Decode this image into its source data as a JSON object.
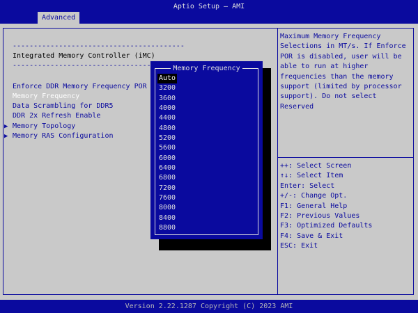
{
  "window": {
    "title": "Aptio Setup – AMI"
  },
  "tabs": [
    {
      "label": "Advanced"
    }
  ],
  "main": {
    "separator": "-----------------------------------------",
    "section_title": "Integrated Memory Controller (iMC)",
    "separator2": "----------------------------------",
    "items": [
      {
        "label": "Enforce DDR Memory Frequency POR"
      },
      {
        "label": "Memory Frequency"
      },
      {
        "label": "Data Scrambling for DDR5"
      },
      {
        "label": "DDR 2x Refresh Enable"
      },
      {
        "label": "Memory Topology"
      },
      {
        "label": "Memory RAS Configuration"
      }
    ]
  },
  "help": {
    "lines": [
      "Maximum Memory Frequency",
      "Selections in MT/s. If Enforce",
      "POR is disabled, user will be",
      "able to run at higher",
      "frequencies than the memory",
      "support (limited by processor",
      "support). Do not select",
      "Reserved"
    ]
  },
  "keys": [
    "++: Select Screen",
    "↑↓: Select Item",
    "Enter: Select",
    "+/-: Change Opt.",
    "F1: General Help",
    "F2: Previous Values",
    "F3: Optimized Defaults",
    "F4: Save & Exit",
    "ESC: Exit"
  ],
  "popup": {
    "title": "Memory Frequency",
    "options": [
      "Auto",
      "3200",
      "3600",
      "4000",
      "4400",
      "4800",
      "5200",
      "5600",
      "6000",
      "6400",
      "6800",
      "7200",
      "7600",
      "8000",
      "8400",
      "8800"
    ]
  },
  "footer": {
    "text": "Version 2.22.1287 Copyright (C) 2023 AMI"
  },
  "colors": {
    "bios_blue": "#0a0a9e",
    "background": "#c9c9c9"
  }
}
